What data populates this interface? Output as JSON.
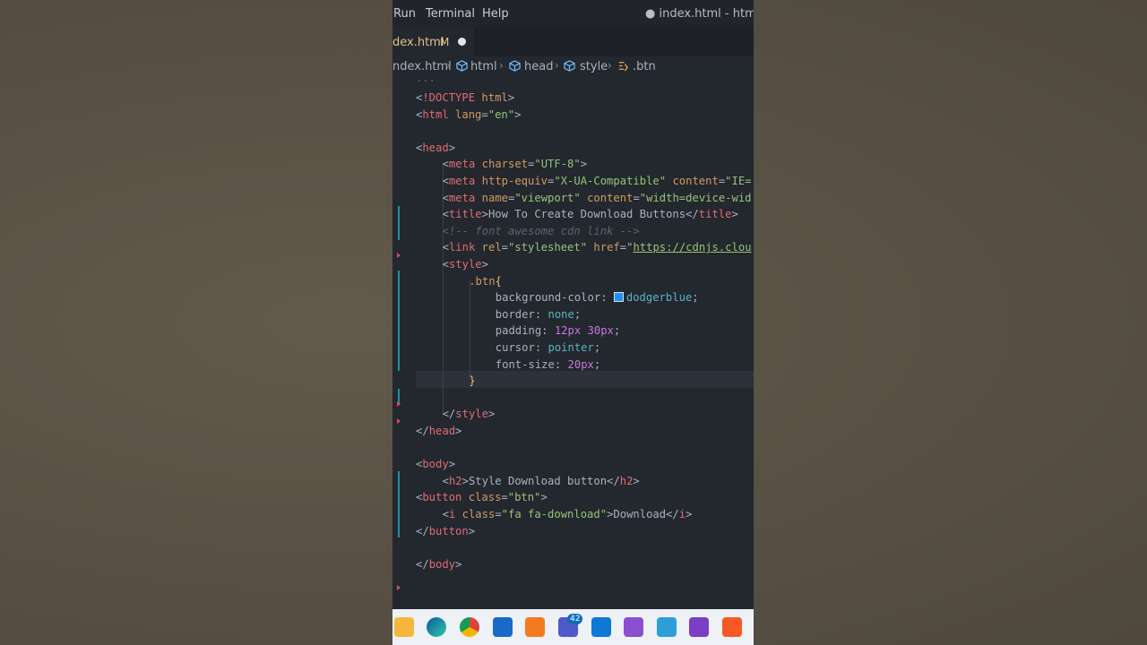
{
  "menubar": {
    "items": [
      "Run",
      "Terminal",
      "Help"
    ],
    "window_title": "● index.html - html - Vi"
  },
  "tab": {
    "label": "dex.html",
    "modified": "M"
  },
  "breadcrumb": {
    "file": "ndex.html",
    "items": [
      "html",
      "head",
      "style",
      ".btn"
    ]
  },
  "editor": {
    "fold_dots": "...",
    "lines": [
      {
        "indent": 0,
        "tokens": [
          [
            "t-plain",
            "<"
          ],
          [
            "t-tag",
            "!DOCTYPE"
          ],
          [
            "t-plain",
            " "
          ],
          [
            "t-attrname",
            "html"
          ],
          [
            "t-plain",
            ">"
          ]
        ]
      },
      {
        "indent": 0,
        "tokens": [
          [
            "t-plain",
            "<"
          ],
          [
            "t-tag",
            "html"
          ],
          [
            "t-plain",
            " "
          ],
          [
            "t-attrname",
            "lang"
          ],
          [
            "t-plain",
            "="
          ],
          [
            "t-str",
            "\"en\""
          ],
          [
            "t-plain",
            ">"
          ]
        ]
      },
      {
        "indent": 0,
        "tokens": []
      },
      {
        "indent": 0,
        "tokens": [
          [
            "t-plain",
            "<"
          ],
          [
            "t-tag",
            "head"
          ],
          [
            "t-plain",
            ">"
          ]
        ]
      },
      {
        "indent": 1,
        "tokens": [
          [
            "t-plain",
            "<"
          ],
          [
            "t-tag",
            "meta"
          ],
          [
            "t-plain",
            " "
          ],
          [
            "t-attrname",
            "charset"
          ],
          [
            "t-plain",
            "="
          ],
          [
            "t-str",
            "\"UTF-8\""
          ],
          [
            "t-plain",
            ">"
          ]
        ]
      },
      {
        "indent": 1,
        "tokens": [
          [
            "t-plain",
            "<"
          ],
          [
            "t-tag",
            "meta"
          ],
          [
            "t-plain",
            " "
          ],
          [
            "t-attrname",
            "http-equiv"
          ],
          [
            "t-plain",
            "="
          ],
          [
            "t-str",
            "\"X-UA-Compatible\""
          ],
          [
            "t-plain",
            " "
          ],
          [
            "t-attrname",
            "content"
          ],
          [
            "t-plain",
            "="
          ],
          [
            "t-str",
            "\"IE="
          ]
        ]
      },
      {
        "indent": 1,
        "tokens": [
          [
            "t-plain",
            "<"
          ],
          [
            "t-tag",
            "meta"
          ],
          [
            "t-plain",
            " "
          ],
          [
            "t-attrname",
            "name"
          ],
          [
            "t-plain",
            "="
          ],
          [
            "t-str",
            "\"viewport\""
          ],
          [
            "t-plain",
            " "
          ],
          [
            "t-attrname",
            "content"
          ],
          [
            "t-plain",
            "="
          ],
          [
            "t-str",
            "\"width=device-wid"
          ]
        ]
      },
      {
        "indent": 1,
        "tokens": [
          [
            "t-plain",
            "<"
          ],
          [
            "t-tag",
            "title"
          ],
          [
            "t-plain",
            ">How To Create Download Buttons</"
          ],
          [
            "t-tag",
            "title"
          ],
          [
            "t-plain",
            ">"
          ]
        ]
      },
      {
        "indent": 1,
        "tokens": [
          [
            "t-cmt",
            "<!-- font awesome cdn link -->"
          ]
        ]
      },
      {
        "indent": 1,
        "tokens": [
          [
            "t-plain",
            "<"
          ],
          [
            "t-tag",
            "link"
          ],
          [
            "t-plain",
            " "
          ],
          [
            "t-attrname",
            "rel"
          ],
          [
            "t-plain",
            "="
          ],
          [
            "t-str",
            "\"stylesheet\""
          ],
          [
            "t-plain",
            " "
          ],
          [
            "t-attrname",
            "href"
          ],
          [
            "t-plain",
            "="
          ],
          [
            "t-str",
            "\""
          ],
          [
            "t-link",
            "https://cdnjs.clou"
          ]
        ]
      },
      {
        "indent": 1,
        "tokens": [
          [
            "t-plain",
            "<"
          ],
          [
            "t-tag",
            "style"
          ],
          [
            "t-plain",
            ">"
          ]
        ]
      },
      {
        "indent": 2,
        "tokens": [
          [
            "t-sel",
            ".btn"
          ],
          [
            "t-brace",
            "{"
          ]
        ]
      },
      {
        "indent": 3,
        "tokens": [
          [
            "t-prop",
            "background-color: "
          ],
          [
            "swatch",
            ""
          ],
          [
            "t-val",
            "dodgerblue"
          ],
          [
            "t-plain",
            ";"
          ]
        ]
      },
      {
        "indent": 3,
        "tokens": [
          [
            "t-prop",
            "border: "
          ],
          [
            "t-val",
            "none"
          ],
          [
            "t-plain",
            ";"
          ]
        ]
      },
      {
        "indent": 3,
        "tokens": [
          [
            "t-prop",
            "padding: "
          ],
          [
            "t-num",
            "12px"
          ],
          [
            "t-plain",
            " "
          ],
          [
            "t-num",
            "30px"
          ],
          [
            "t-plain",
            ";"
          ]
        ]
      },
      {
        "indent": 3,
        "tokens": [
          [
            "t-prop",
            "cursor: "
          ],
          [
            "t-val",
            "pointer"
          ],
          [
            "t-plain",
            ";"
          ]
        ]
      },
      {
        "indent": 3,
        "tokens": [
          [
            "t-prop",
            "font-size: "
          ],
          [
            "t-num",
            "20px"
          ],
          [
            "t-plain",
            ";"
          ]
        ]
      },
      {
        "indent": 2,
        "tokens": [
          [
            "t-brace",
            "}"
          ]
        ]
      },
      {
        "indent": 0,
        "tokens": []
      },
      {
        "indent": 1,
        "tokens": [
          [
            "t-plain",
            "</"
          ],
          [
            "t-tag",
            "style"
          ],
          [
            "t-plain",
            ">"
          ]
        ]
      },
      {
        "indent": 0,
        "tokens": [
          [
            "t-plain",
            "</"
          ],
          [
            "t-tag",
            "head"
          ],
          [
            "t-plain",
            ">"
          ]
        ]
      },
      {
        "indent": 0,
        "tokens": []
      },
      {
        "indent": 0,
        "tokens": [
          [
            "t-plain",
            "<"
          ],
          [
            "t-tag",
            "body"
          ],
          [
            "t-plain",
            ">"
          ]
        ]
      },
      {
        "indent": 1,
        "tokens": [
          [
            "t-plain",
            "<"
          ],
          [
            "t-tag",
            "h2"
          ],
          [
            "t-plain",
            ">Style Download button</"
          ],
          [
            "t-tag",
            "h2"
          ],
          [
            "t-plain",
            ">"
          ]
        ]
      },
      {
        "indent": 0,
        "tokens": [
          [
            "t-plain",
            "<"
          ],
          [
            "t-tag",
            "button"
          ],
          [
            "t-plain",
            " "
          ],
          [
            "t-attrname",
            "class"
          ],
          [
            "t-plain",
            "="
          ],
          [
            "t-str",
            "\"btn\""
          ],
          [
            "t-plain",
            ">"
          ]
        ]
      },
      {
        "indent": 1,
        "tokens": [
          [
            "t-plain",
            "<"
          ],
          [
            "t-tag",
            "i"
          ],
          [
            "t-plain",
            " "
          ],
          [
            "t-attrname",
            "class"
          ],
          [
            "t-plain",
            "="
          ],
          [
            "t-str",
            "\"fa fa-download\""
          ],
          [
            "t-plain",
            ">Download</"
          ],
          [
            "t-tag",
            "i"
          ],
          [
            "t-plain",
            ">"
          ]
        ]
      },
      {
        "indent": 0,
        "tokens": [
          [
            "t-plain",
            "</"
          ],
          [
            "t-tag",
            "button"
          ],
          [
            "t-plain",
            ">"
          ]
        ]
      },
      {
        "indent": 0,
        "tokens": []
      },
      {
        "indent": 0,
        "tokens": [
          [
            "t-plain",
            "</"
          ],
          [
            "t-tag",
            "body"
          ],
          [
            "t-plain",
            ">"
          ]
        ]
      }
    ]
  },
  "taskbar": {
    "icons": [
      "file-explorer-icon",
      "edge-browser-icon",
      "chrome-icon",
      "store-icon",
      "xampp-icon",
      "teams-icon",
      "mail-icon",
      "visual-studio-icon",
      "tools-icon",
      "visual-studio-2-icon",
      "brave-icon"
    ],
    "badge": "42"
  },
  "colors": {
    "editor_bg": "#23272e",
    "tag": "#e06c75",
    "string": "#98c379",
    "attribute": "#d19a66",
    "number": "#c678dd",
    "value": "#56b6c2",
    "dodgerblue": "#1e90ff"
  }
}
